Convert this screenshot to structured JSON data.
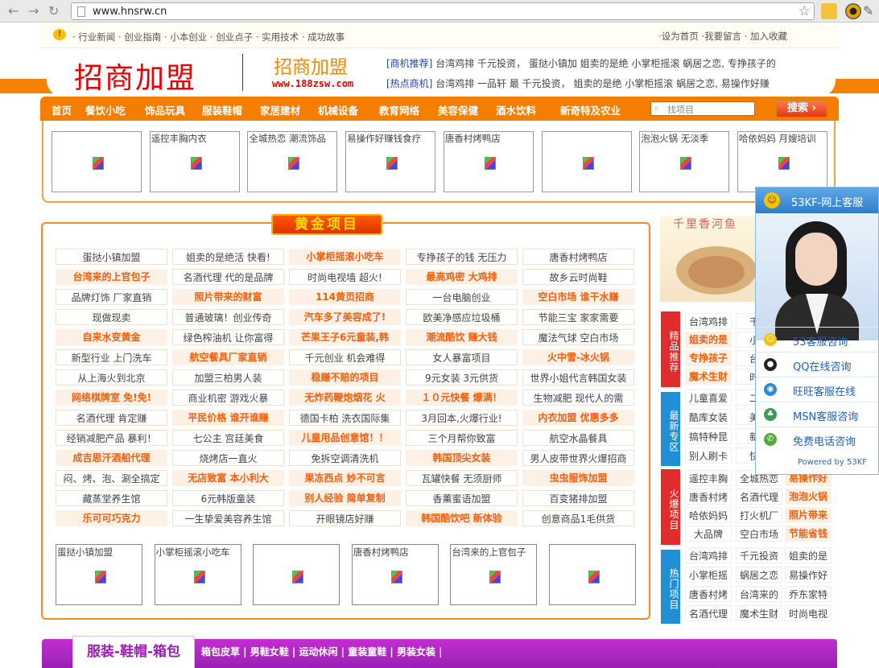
{
  "browser": {
    "url": "www.hnsrw.cn"
  },
  "topbar": {
    "left": "· 行业新闻 · 创业指南 · 小本创业 · 创业点子 · 实用技术 · 成功故事",
    "right": "·设为首页 ·我要留言 · 加入收藏"
  },
  "logo": {
    "main": "招商加盟",
    "side": "招商加盟",
    "url": "www.188zsw.com"
  },
  "news": {
    "line1_tag": "[商机推荐]",
    "line1": "台湾鸡排 千元投资，  蛋挞小镇加 姐卖的是绝 小掌柜摇滚 蜗居之恋, 专挣孩子的",
    "line2_tag": "[热点商机]",
    "line2": "台湾鸡排 一品轩 最 千元投资，  姐卖的是绝 小掌柜摇滚 蜗居之恋, 易操作好赚"
  },
  "nav": [
    "首页",
    "餐饮小吃",
    "饰品玩具",
    "服装鞋帽",
    "家居建材",
    "机械设备",
    "教育网络",
    "美容保健",
    "酒水饮料",
    "新奇特及农业"
  ],
  "search": {
    "placeholder": "找项目",
    "button": "搜索 ›"
  },
  "top_ads": [
    "",
    "遥控丰胸内衣",
    "全城热恋 潮流饰品",
    "易操作好赚钱食疗",
    "唐香村烤鸭店",
    "",
    "泡泡火锅 无淡季",
    "哈依妈妈 月嫂培训"
  ],
  "gold": {
    "title": "黄金项目",
    "rows": [
      [
        "蛋挞小镇加盟",
        "姐卖的是绝活 快看!",
        "小掌柜摇滚小吃车",
        "专挣孩子的钱 无压力",
        "唐香村烤鸭店"
      ],
      [
        "台湾来的上官包子",
        "名酒代理 代的是品牌",
        "时尚电视墙 超火!",
        "最高鸡密 大鸡排",
        "故乡云时尚鞋"
      ],
      [
        "品牌灯饰 厂家直销",
        "照片带来的财富",
        "114黄页招商",
        "一台电脑创业",
        "空白市场 谁干水赚"
      ],
      [
        "现做现卖",
        "普通玻璃！创业传奇",
        "汽车多了美容成了!",
        "欧美净感应垃圾桶",
        "节能三宝 家家需要"
      ],
      [
        "自来水变黄金",
        "绿色榨油机 让你富得",
        "芒果王子6元童装,韩",
        "潮流酷饮 赚大钱",
        "魔法气球 空白市场"
      ],
      [
        "新型行业 上门洗车",
        "航空餐具厂家直销",
        "千元创业 机会难得",
        "女人暴富项目",
        "火中雪-冰火锅"
      ],
      [
        "从上海火到北京",
        "加盟三柏男人装",
        "稳赚不赔的项目",
        "9元女装 3元供货",
        "世界小姐代言韩国女装"
      ],
      [
        "网络棋牌室 免!免!",
        "商业机密 游戏火暴",
        "无炸药鞭炮烟花 火",
        "１０元快餐 爆满！",
        "生物减肥 现代人的需"
      ],
      [
        "名酒代理 肯定赚",
        "平民价格 谁开谁赚",
        "德国卡柏 洗衣国际集",
        "3月回本,火爆行业!",
        "内衣加盟 优惠多多"
      ],
      [
        "经销减肥产品 暴利！",
        "七公主 宫廷美食",
        "儿童用品创意馆！！",
        "三个月帮你致富",
        "航空水晶餐具"
      ],
      [
        "成吉思汗酒船代理",
        "烧烤店一直火",
        "免拆空调清洗机",
        "韩国顶尖女装",
        "男人皮带世界火爆招商"
      ],
      [
        "闷、烤、泡、涮全搞定",
        "无店致富 本小利大",
        "果冻西点 妙不可言",
        "瓦罐快餐 无须厨师",
        "虫虫服饰加盟"
      ],
      [
        "藏蒸堂养生馆",
        "6元韩版童装",
        "别人经验 简单复制",
        "香薰蜜语加盟",
        "百变猪排加盟"
      ],
      [
        "乐可可巧克力",
        "一生挚爱美容养生馆",
        "开眼镜店好赚",
        "韩国酷饮吧 新体验",
        "创意商品1毛供货"
      ]
    ],
    "bottom_ads": [
      "蛋挞小镇加盟",
      "小掌柜摇滚小吃车",
      "",
      "唐香村烤鸭店",
      "台湾来的上官包子",
      ""
    ]
  },
  "right": {
    "img_text": "千里香河鱼",
    "tags": [
      "精品推荐",
      "最新专区",
      "火爆项目",
      "热门项目"
    ],
    "rows": [
      [
        "台湾鸡排",
        "千元"
      ],
      [
        "姐卖的是",
        "小掌"
      ],
      [
        "专挣孩子",
        "台湾"
      ],
      [
        "魔术生财",
        "时尚"
      ],
      [
        "儿童喜爱",
        "二合"
      ],
      [
        "酷库女装",
        "美容"
      ],
      [
        "搞特种昆",
        "新奇"
      ],
      [
        "别人刷卡",
        "快抢"
      ],
      [
        "遥控丰胸",
        "全城热恋",
        "易操作好"
      ],
      [
        "唐香村烤",
        "名酒代理",
        "泡泡火锅"
      ],
      [
        "哈依妈妈",
        "打火机厂",
        "照片带来"
      ],
      [
        "大品牌",
        "空白市场",
        "节能省钱"
      ],
      [
        "台湾鸡排",
        "千元投资",
        "姐卖的是"
      ],
      [
        "小掌柜摇",
        "蜗居之恋",
        "易操作好"
      ],
      [
        "唐香村烤",
        "台湾来的",
        "乔东家特"
      ],
      [
        "名酒代理",
        "魔术生财",
        "时尚电视"
      ]
    ]
  },
  "kf": {
    "title": "53KF-网上客服",
    "items": [
      "53客服咨询",
      "QQ在线咨询",
      "旺旺客服在线",
      "MSN客服咨询",
      "免费电话咨询"
    ],
    "powered": "Powered by 53KF"
  },
  "cloth": {
    "tab": "服装-鞋帽-箱包",
    "links": "箱包皮草 | 男鞋女鞋 | 运动休闲 | 童装童鞋 | 男装女装 |"
  },
  "colors": {
    "orange": "#f57e00",
    "highlight": "#f06010",
    "purple": "#a026be",
    "blue": "#2f7cc9"
  }
}
